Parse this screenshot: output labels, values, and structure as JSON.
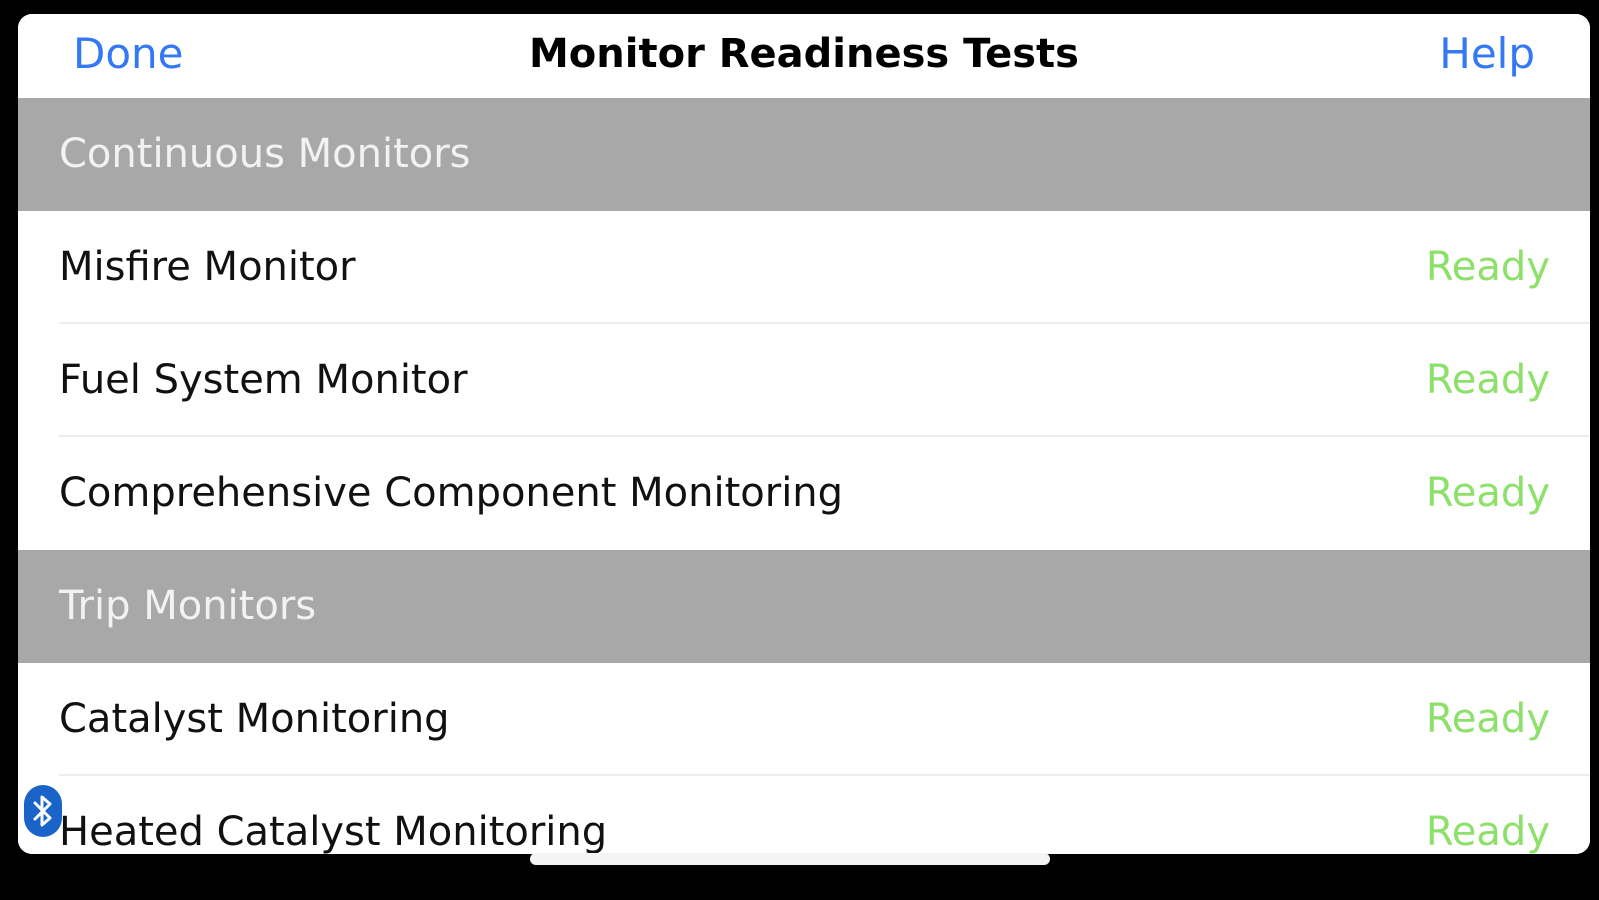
{
  "navbar": {
    "done_label": "Done",
    "title": "Monitor Readiness Tests",
    "help_label": "Help"
  },
  "sections": [
    {
      "header": "Continuous Monitors",
      "rows": [
        {
          "label": "Misfire Monitor",
          "status": "Ready"
        },
        {
          "label": "Fuel System Monitor",
          "status": "Ready"
        },
        {
          "label": "Comprehensive Component Monitoring",
          "status": "Ready"
        }
      ]
    },
    {
      "header": "Trip Monitors",
      "rows": [
        {
          "label": "Catalyst Monitoring",
          "status": "Ready"
        },
        {
          "label": "Heated Catalyst Monitoring",
          "status": "Ready"
        }
      ]
    }
  ],
  "colors": {
    "accent": "#3478f6",
    "ready": "#8de06a",
    "section_bg": "#a8a8a8"
  },
  "icons": {
    "bluetooth": "bluetooth-icon"
  }
}
